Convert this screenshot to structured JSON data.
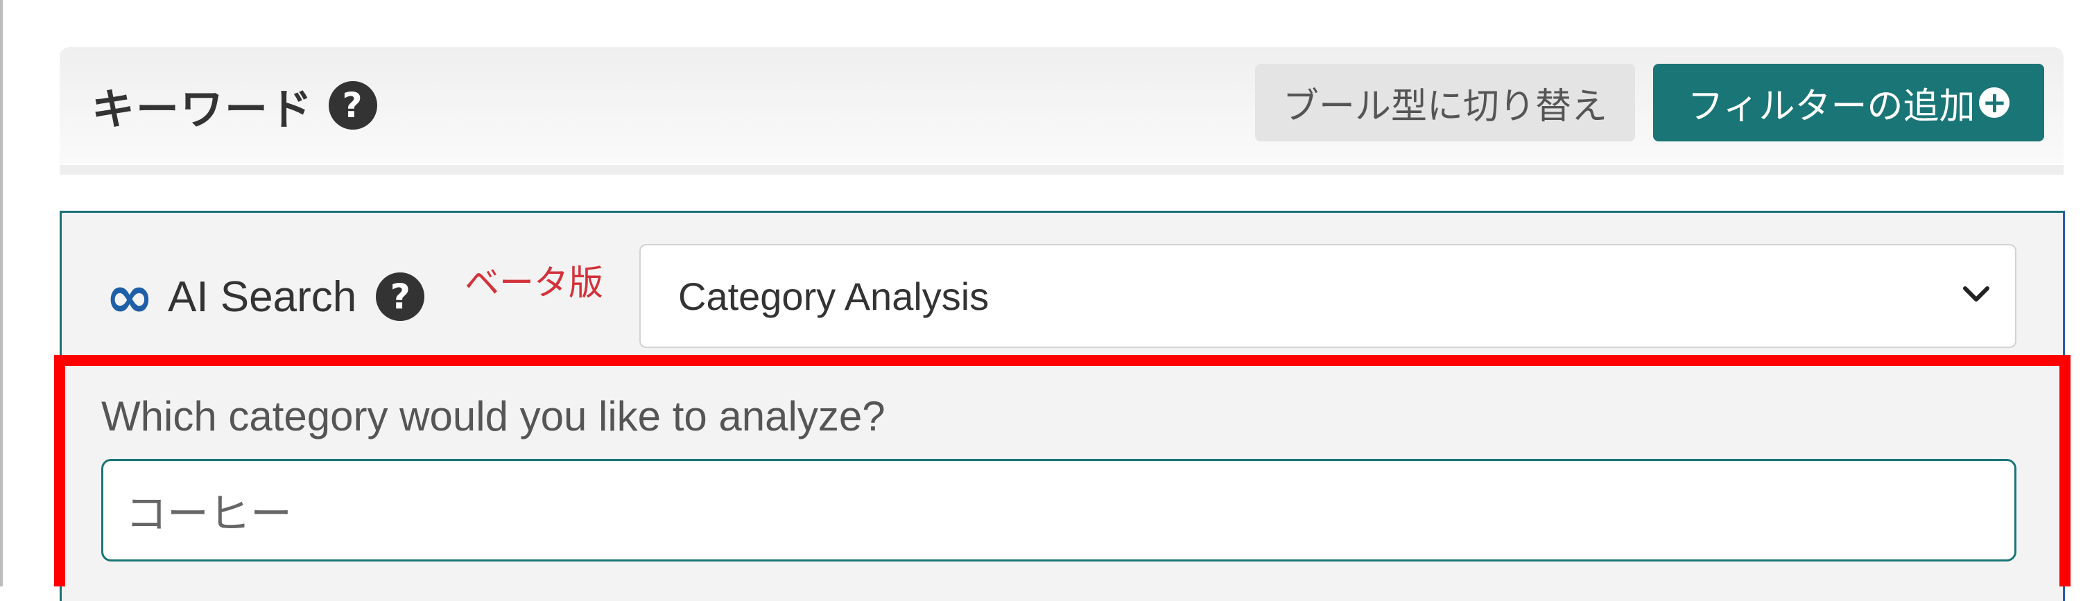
{
  "header": {
    "title": "キーワード",
    "help_icon": "question-circle-icon",
    "boolean_button_label": "ブール型に切り替え",
    "add_filter_label": "フィルターの追加",
    "add_filter_icon": "plus-circle-icon",
    "accent_color": "#1a7576"
  },
  "ai_search": {
    "icon": "infinity-icon",
    "label": "AI Search",
    "help_icon": "question-circle-icon",
    "beta_label": "ベータ版",
    "beta_color": "#d3323a",
    "mode_selected": "Category Analysis",
    "question": "Which category would you like to analyze?",
    "category_value": "コーヒー"
  },
  "highlight_color": "#ff0000"
}
